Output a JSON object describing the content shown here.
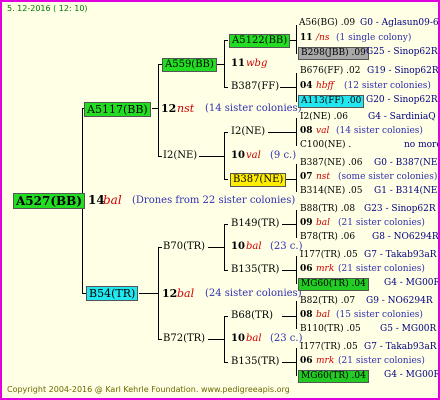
{
  "header": "5. 12-2016 ( 12: 10)",
  "footer": "Copyright 2004-2016 @ Karl Kehrle Foundation.   www.pedigreeapis.org",
  "root": {
    "id": "A527(BB)",
    "num": "14",
    "name": "bal",
    "note": "(Drones from 22 sister colonies)"
  },
  "p": {
    "id": "A5117(BB)",
    "num": "12",
    "name": "nst",
    "note": "(14 sister colonies)"
  },
  "m": {
    "id": "B54(TR)",
    "num": "12",
    "name": "bal",
    "note": "(24 sister colonies)"
  },
  "pp": {
    "id": "A559(BB)",
    "num": "11",
    "name": "wbg"
  },
  "pm": {
    "id": "I2(NE)",
    "num": "10",
    "name": "val",
    "note": "(9 c.)"
  },
  "mp": {
    "id": "B70(TR)",
    "num": "10",
    "name": "bal",
    "note": "(23 c.)"
  },
  "mm": {
    "id": "B72(TR)",
    "num": "10",
    "name": "bal",
    "note": "(23 c.)"
  },
  "g3": {
    "a1": "A5122(BB)",
    "a2": "B387(FF)",
    "a3": "I2(NE)",
    "a4": "B387(NE)",
    "a5": "B149(TR)",
    "a6": "B135(TR)",
    "a7": "B68(TR)",
    "a8": "B135(TR)"
  },
  "g3mid": {
    "m2": {
      "num": "11",
      "name": "wbg"
    },
    "m3": {
      "num": "10",
      "name": "val",
      "note": "(9 c.)"
    }
  },
  "g4": [
    {
      "t1": "A56(BG) .09",
      "t1b": "G0 - Aglasun09-6",
      "n": "11",
      "name": "/ns",
      "note": "(1 single colony)",
      "t2": "B298(JBB) .09",
      "t2b": "G25 - Sinop62R"
    },
    {
      "t1": "B676(FF) .02",
      "t1b": "G19 - Sinop62R",
      "n": "04",
      "name": "hbff",
      "note": "(12 sister colonies)",
      "t2": "A113(FF) .00",
      "t2b": "G20 - Sinop62R"
    },
    {
      "t1": "I2(NE) .06",
      "t1b": "G4 - SardiniaQ",
      "n": "08",
      "name": "val",
      "note": "(14 sister colonies)",
      "t2": "C100(NE) .",
      "t2b": "no more"
    },
    {
      "t1": "B387(NE) .06",
      "t1b": "G0 - B387(NE)",
      "n": "07",
      "name": "nst",
      "note": "(some sister colonies)",
      "t2": "B314(NE) .05",
      "t2b": "G1 - B314(NE)"
    },
    {
      "t1": "B88(TR) .08",
      "t1b": "G23 - Sinop62R",
      "n": "09",
      "name": "bal",
      "note": "(21 sister colonies)",
      "t2": "B78(TR) .06",
      "t2b": "G8 - NO6294R"
    },
    {
      "t1": "I177(TR) .05",
      "t1b": "G7 - Takab93aR",
      "n": "06",
      "name": "mrk",
      "note": "(21 sister colonies)",
      "t2": "MG60(TR) .04",
      "t2b": "G4 - MG00R"
    },
    {
      "t1": "B82(TR) .07",
      "t1b": "G9 - NO6294R",
      "n": "08",
      "name": "bal",
      "note": "(15 sister colonies)",
      "t2": "B110(TR) .05",
      "t2b": "G5 - MG00R"
    },
    {
      "t1": "I177(TR) .05",
      "t1b": "G7 - Takab93aR",
      "n": "06",
      "name": "mrk",
      "note": "(21 sister colonies)",
      "t2": "MG60(TR) .04",
      "t2b": "G4 - MG00R"
    }
  ]
}
